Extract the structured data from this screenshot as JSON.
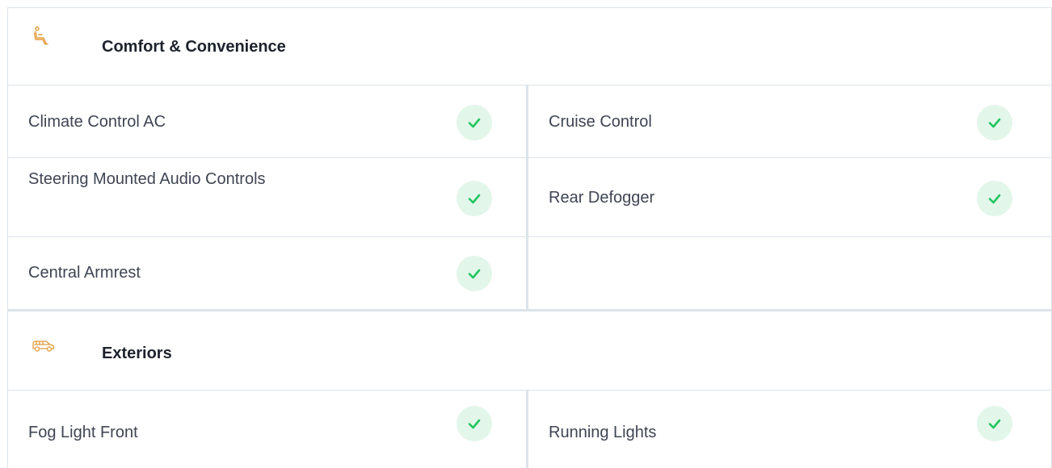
{
  "sections": [
    {
      "title": "Comfort & Convenience",
      "icon": "seat-icon",
      "rows": [
        {
          "left": {
            "label": "Climate Control AC",
            "available": true
          },
          "right": {
            "label": "Cruise Control",
            "available": true
          }
        },
        {
          "left": {
            "label": "Steering Mounted Audio Controls",
            "available": true
          },
          "right": {
            "label": "Rear Defogger",
            "available": true
          }
        },
        {
          "left": {
            "label": "Central Armrest",
            "available": true
          },
          "right": null
        }
      ]
    },
    {
      "title": "Exteriors",
      "icon": "car-icon",
      "rows": [
        {
          "left": {
            "label": "Fog Light Front",
            "available": true
          },
          "right": {
            "label": "Running Lights",
            "available": true
          }
        }
      ]
    }
  ],
  "colors": {
    "check": "#22c55e",
    "check_bg": "#e3f6ea",
    "icon": "#e39a3b",
    "border": "#dde3ea"
  }
}
